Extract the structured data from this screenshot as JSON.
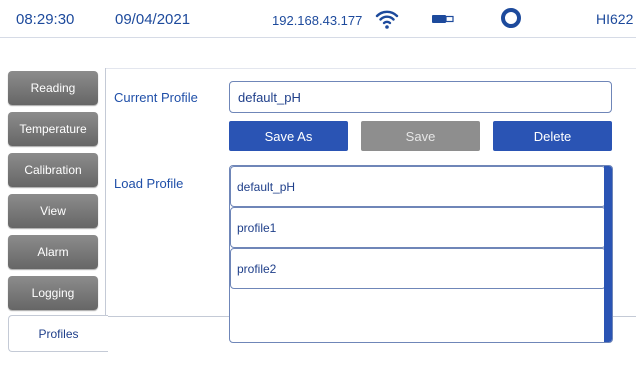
{
  "status_bar": {
    "time": "08:29:30",
    "date": "09/04/2021",
    "ip": "192.168.43.177",
    "model": "HI622",
    "icons": [
      "wifi-icon",
      "usb-icon",
      "ring-icon"
    ]
  },
  "sidebar": {
    "items": [
      {
        "label": "Reading"
      },
      {
        "label": "Temperature"
      },
      {
        "label": "Calibration"
      },
      {
        "label": "View"
      },
      {
        "label": "Alarm"
      },
      {
        "label": "Logging"
      },
      {
        "label": "Profiles",
        "active": true
      }
    ]
  },
  "profiles": {
    "current_profile_label": "Current Profile",
    "current_profile_value": "default_pH",
    "load_profile_label": "Load Profile",
    "buttons": {
      "save_as": "Save As",
      "save": "Save",
      "delete": "Delete"
    },
    "list": [
      "default_pH",
      "profile1",
      "profile2"
    ]
  },
  "colors": {
    "accent": "#2a54b4",
    "text": "#1f3f8a",
    "tab_gray": "#777777",
    "disabled": "#8e8e8e"
  }
}
